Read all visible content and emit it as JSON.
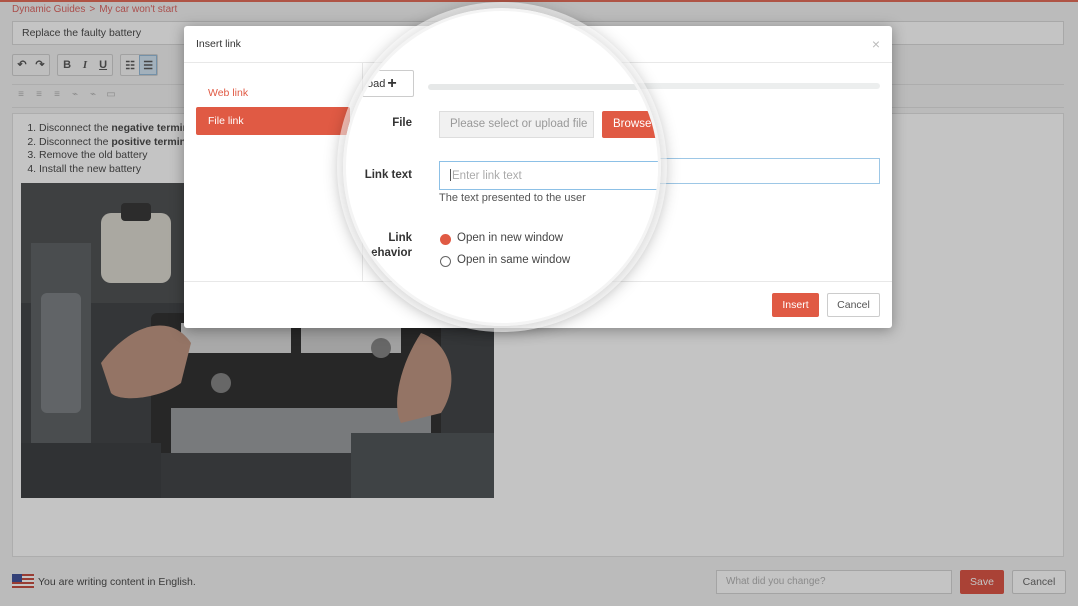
{
  "breadcrumb": {
    "root": "Dynamic Guides",
    "separator": ">",
    "current": "My car won't start"
  },
  "title_field": {
    "value": "Replace the faulty battery"
  },
  "toolbar": {
    "undo_icon": "undo-icon",
    "redo_icon": "redo-icon",
    "bold": "B",
    "italic": "I",
    "underline": "U",
    "bullets_icon": "bulleted-list-icon",
    "numbers_icon": "numbered-list-icon"
  },
  "editor": {
    "steps": [
      {
        "before": "Disconnect the ",
        "bold": "negative terminal",
        "after": ""
      },
      {
        "before": "Disconnect the ",
        "bold": "positive terminal",
        "after": ""
      },
      {
        "before": "Remove the old battery",
        "bold": "",
        "after": ""
      },
      {
        "before": "Install the new battery",
        "bold": "",
        "after": ""
      }
    ]
  },
  "footer": {
    "language_text": "You are writing content in English.",
    "change_placeholder": "What did you change?",
    "save_label": "Save",
    "cancel_label": "Cancel"
  },
  "modal": {
    "title": "Insert link",
    "close_glyph": "×",
    "tabs": [
      {
        "label": "Web link",
        "active": false
      },
      {
        "label": "File link",
        "active": true
      }
    ],
    "upload_label": "oad",
    "upload_glyph": "+",
    "file_label": "File",
    "file_placeholder": "Please select or upload file",
    "browse_label": "Browse",
    "link_text_label": "Link text",
    "link_text_placeholder": "Enter link text",
    "link_text_help": "The text presented to the user",
    "behavior_label_1": "Link",
    "behavior_label_2": "behavior",
    "behavior_options": [
      {
        "label": "Open in new window",
        "selected": true
      },
      {
        "label": "Open in same window",
        "selected": false
      }
    ],
    "insert_label": "Insert",
    "cancel_label": "Cancel"
  },
  "colors": {
    "accent": "#e05a44",
    "save": "#d9402f",
    "focus_border": "#8cc0e6"
  }
}
